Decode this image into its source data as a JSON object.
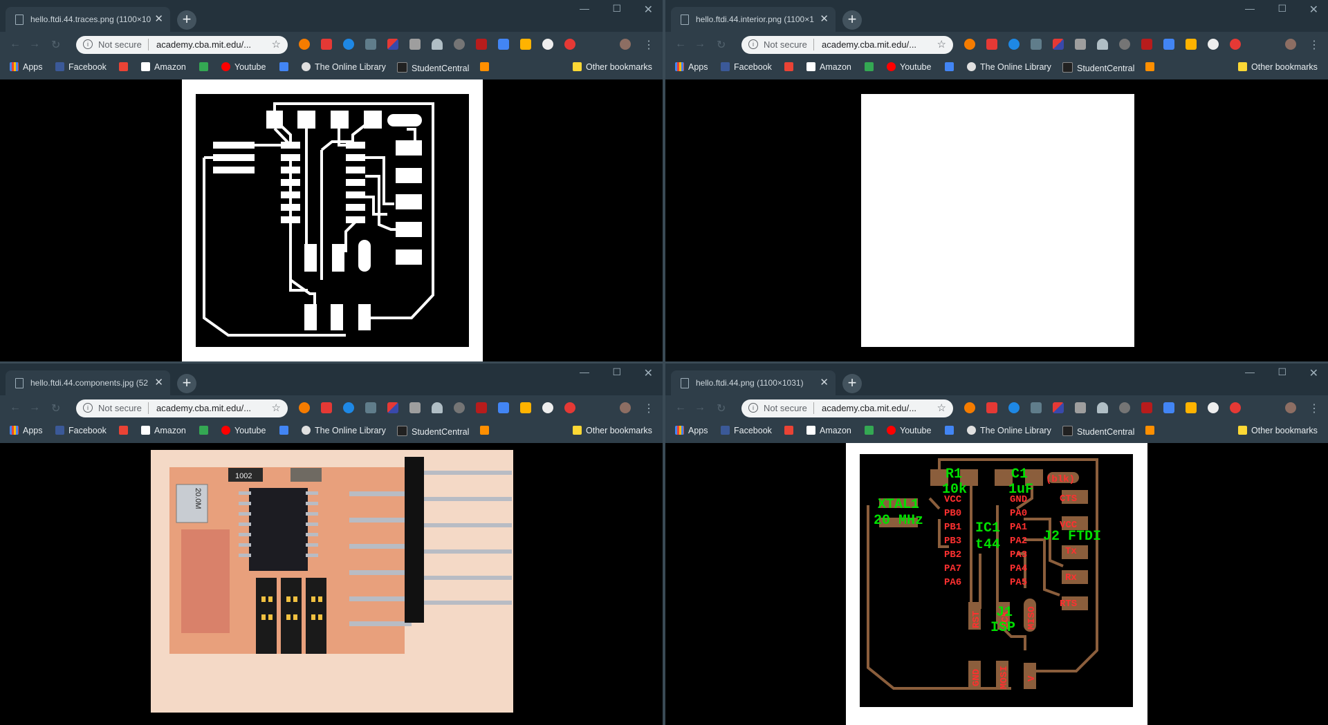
{
  "windows": [
    {
      "tab_title": "hello.ftdi.44.traces.png (1100×10",
      "url": "academy.cba.mit.edu/..."
    },
    {
      "tab_title": "hello.ftdi.44.interior.png (1100×1",
      "url": "academy.cba.mit.edu/..."
    },
    {
      "tab_title": "hello.ftdi.44.components.jpg (52",
      "url": "academy.cba.mit.edu/..."
    },
    {
      "tab_title": "hello.ftdi.44.png (1100×1031)",
      "url": "academy.cba.mit.edu/..."
    }
  ],
  "omnibox": {
    "security_text": "Not secure"
  },
  "bookmarks": {
    "apps": "Apps",
    "facebook": "Facebook",
    "amazon": "Amazon",
    "youtube": "Youtube",
    "online_library": "The Online Library",
    "student_central": "StudentCentral",
    "other": "Other bookmarks"
  },
  "component_labels": {
    "r1": "R1",
    "r1_val": "10k",
    "c1": "C1",
    "c1_val": "1uF",
    "blk": "(blk)",
    "xtal": "XTAL1",
    "xtal_val": "20 MHz",
    "ic": "IC1",
    "ic_val": "t44",
    "j2": "J2 FTDI",
    "j1": "J1",
    "isp": "ISP",
    "vcc": "VCC",
    "gnd": "GND",
    "pb0": "PB0",
    "pb1": "PB1",
    "pb3": "PB3",
    "pb2": "PB2",
    "pa7": "PA7",
    "pa6": "PA6",
    "pa0": "PA0",
    "pa1": "PA1",
    "pa2": "PA2",
    "pa3": "PA3",
    "pa4": "PA4",
    "pa5": "PA5",
    "cts": "CTS",
    "vcc2": "VCC",
    "tx": "Tx",
    "rx": "Rx",
    "rts": "RTS",
    "rst": "RST",
    "sck": "SCK",
    "miso": "MISO",
    "mosi": "MOSI",
    "gnd2": "GND",
    "v": "V",
    "chip_text": "1002",
    "xtal_text": "20.0M"
  },
  "colors": {
    "chrome_bg": "#2f3e49",
    "label_green": "#00e000",
    "label_red": "#ff3030",
    "trace_brown": "#8b5e3c"
  }
}
